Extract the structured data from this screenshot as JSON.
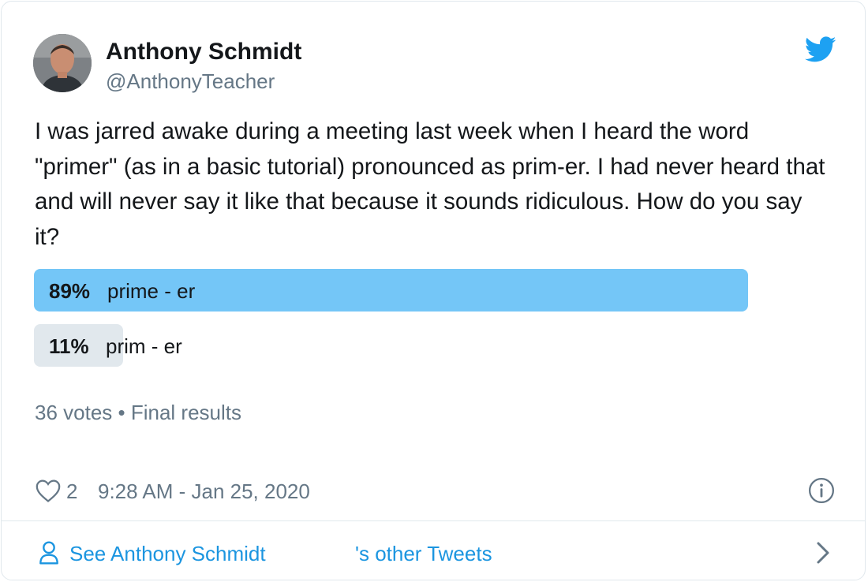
{
  "author": {
    "name": "Anthony Schmidt",
    "handle": "@AnthonyTeacher"
  },
  "tweet": {
    "text": "I was jarred awake during a meeting last week when I heard the word \"primer\" (as in a basic tutorial) pronounced as prim-er. I had never heard that and will never say it like that because it sounds ridiculous. How do you say it?"
  },
  "poll": {
    "options": [
      {
        "percent": "89%",
        "label": "prime - er",
        "fraction": 0.89
      },
      {
        "percent": "11%",
        "label": "prim - er",
        "fraction": 0.11
      }
    ],
    "meta": "36 votes • Final results"
  },
  "footer": {
    "likes": "2",
    "timestamp": "9:28 AM - Jan 25, 2020"
  },
  "cta": {
    "part1": "See Anthony Schmidt",
    "part2": "'s other Tweets"
  },
  "colors": {
    "bar_leading": "#74c6f7",
    "bar_other": "#e1e8ed",
    "link": "#1b95e0",
    "twitter_blue": "#1da1f2"
  },
  "icons": [
    "avatar",
    "twitter-bird-icon",
    "heart-icon",
    "info-icon",
    "person-icon",
    "chevron-right-icon"
  ]
}
